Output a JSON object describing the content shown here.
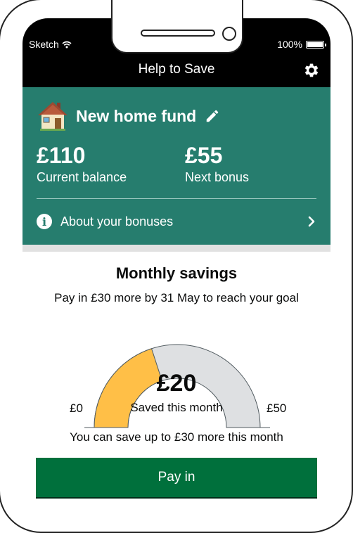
{
  "status": {
    "carrier": "Sketch",
    "battery": "100%"
  },
  "nav": {
    "title": "Help to Save",
    "settings_icon": "gear-icon"
  },
  "fund": {
    "name": "New home fund",
    "icon": "house-icon",
    "balance": "£110",
    "balance_label": "Current balance",
    "bonus": "£55",
    "bonus_label": "Next bonus",
    "about_label": "About your bonuses"
  },
  "savings": {
    "title": "Monthly savings",
    "subtitle": "Pay in £30 more by 31 May to reach your goal",
    "saved_amount": "£20",
    "saved_label": "Saved this month",
    "min_label": "£0",
    "max_label": "£50",
    "progress_fraction": 0.4,
    "note": "You can save up to £30 more this month",
    "pay_in_label": "Pay in"
  },
  "colors": {
    "hero": "#267d6e",
    "gauge_fill": "#ffbf47",
    "gauge_track": "#dee0e2",
    "button": "#00703c"
  }
}
